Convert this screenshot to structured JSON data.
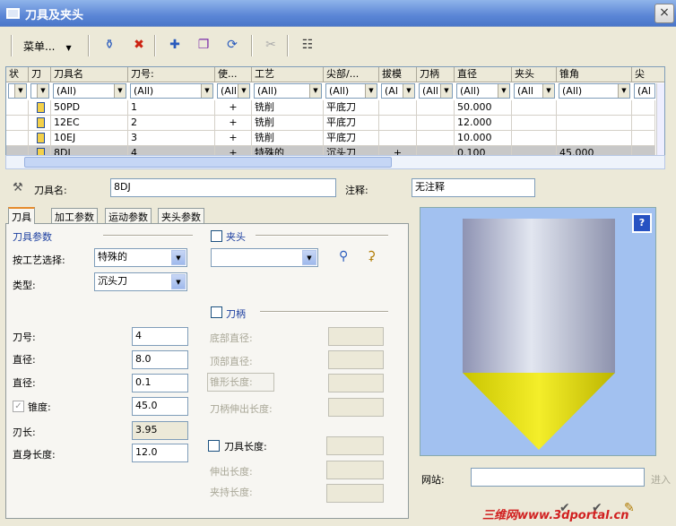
{
  "window": {
    "title": "刀具及夹头",
    "close_label": "×"
  },
  "toolbar": {
    "menu_label": "菜单..."
  },
  "grid": {
    "headers": [
      "状",
      "刀",
      "刀具名",
      "刀号:",
      "使...",
      "工艺",
      "尖部/...",
      "拔模",
      "刀柄",
      "直径",
      "夹头",
      "锥角",
      "尖"
    ],
    "filter_value": "(All)",
    "filters": [
      "",
      "",
      "(All)",
      "(All)",
      "(All",
      "(All)",
      "(All)",
      "(Al",
      "(All",
      "(All)",
      "(All",
      "(All)",
      "(Al"
    ],
    "rows": [
      {
        "name": "50PD",
        "num": "1",
        "use": "+",
        "process": "铣削",
        "tip": "平底刀",
        "draft": "",
        "holder": "",
        "diameter": "50.000",
        "chuck": "",
        "angle": ""
      },
      {
        "name": "12EC",
        "num": "2",
        "use": "+",
        "process": "铣削",
        "tip": "平底刀",
        "draft": "",
        "holder": "",
        "diameter": "12.000",
        "chuck": "",
        "angle": ""
      },
      {
        "name": "10EJ",
        "num": "3",
        "use": "+",
        "process": "铣削",
        "tip": "平底刀",
        "draft": "",
        "holder": "",
        "diameter": "10.000",
        "chuck": "",
        "angle": ""
      },
      {
        "name": "8DJ",
        "num": "4",
        "use": "+",
        "process": "特殊的",
        "tip": "沉头刀",
        "draft": "+",
        "holder": "",
        "diameter": "0.100",
        "chuck": "",
        "angle": "45.000"
      }
    ]
  },
  "form": {
    "tool_name_label": "刀具名:",
    "tool_name_value": "8DJ",
    "comment_label": "注释:",
    "comment_value": "无注释",
    "tabs": [
      "刀具",
      "加工参数",
      "运动参数",
      "夹头参数"
    ],
    "tool_params_title": "刀具参数",
    "process_select_label": "按工艺选择:",
    "process_select_value": "特殊的",
    "type_label": "类型:",
    "type_value": "沉头刀",
    "tool_num_label": "刀号:",
    "tool_num_value": "4",
    "diameter_label": "直径:",
    "diameter_value": "8.0",
    "diameter2_label": "直径:",
    "diameter2_value": "0.1",
    "taper_label": "锥度:",
    "taper_value": "45.0",
    "blade_len_label": "刃长:",
    "blade_len_value": "3.95",
    "body_len_label": "直身长度:",
    "body_len_value": "12.0",
    "chuck_label": "夹头",
    "shank_label": "刀柄",
    "bottom_dia_label": "底部直径:",
    "top_dia_label": "顶部直径:",
    "taper_len_label": "锥形长度:",
    "shank_ext_label": "刀柄伸出长度:",
    "tool_len_label": "刀具长度:",
    "ext_len_label": "伸出长度:",
    "clamp_len_label": "夹持长度:",
    "website_label": "网站:",
    "website_value": "",
    "website_go": "进入",
    "watermark": "三维网www.3dportal.cn"
  }
}
